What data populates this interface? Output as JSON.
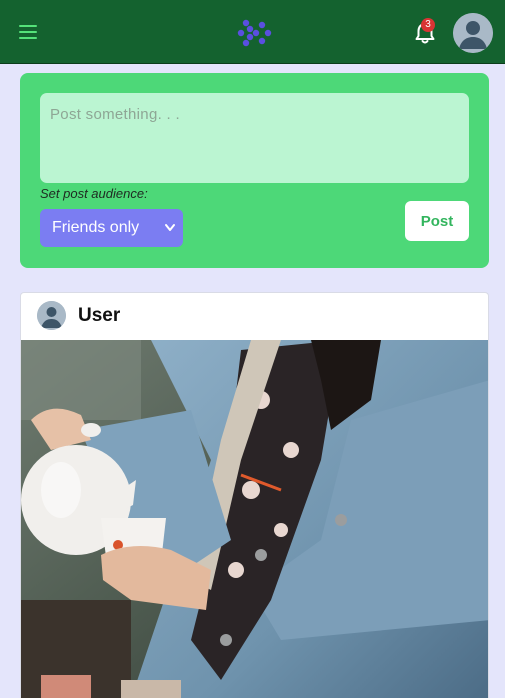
{
  "topbar": {
    "menu_icon": "hamburger-menu-icon",
    "logo_icon": "app-logo-icon",
    "notification_icon": "bell-icon",
    "notification_count": "3",
    "profile_icon": "user-avatar-icon"
  },
  "composer": {
    "placeholder": "Post something. . .",
    "audience_label": "Set post audience:",
    "audience_selected": "Friends only",
    "post_label": "Post"
  },
  "post": {
    "username": "User",
    "image_icon": "photo-woman-pouring-tea"
  },
  "colors": {
    "topbar": "#14622f",
    "accent_green": "#4dd878",
    "input_bg": "#bbf5d2",
    "select_bg": "#7b7df2",
    "page_bg": "#e4e5fb",
    "badge": "#d93434"
  }
}
